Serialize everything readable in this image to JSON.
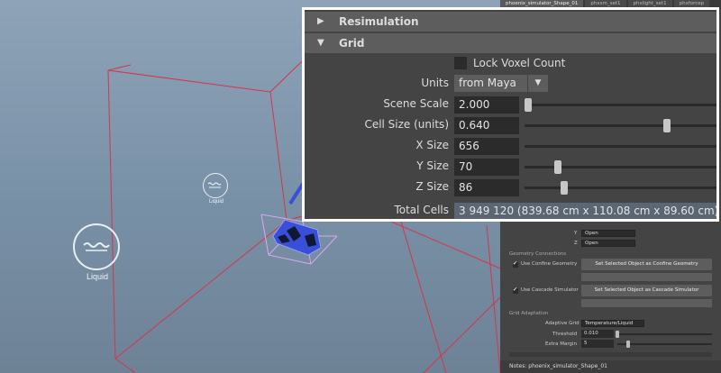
{
  "viewport": {
    "liquid_label": "Liquid",
    "liquid_label_small": "Liquid"
  },
  "attr_editor": {
    "node_tabs": [
      "phoenix_simulator_Shape_01",
      "phxsm_set1",
      "phxlight_set1",
      "phxforcep"
    ],
    "y_label": "Y",
    "y_value": "Open",
    "z_label": "Z",
    "z_value": "Open",
    "geometry_connections": "Geometry Connections",
    "use_confine_geometry": "Use Confine Geometry",
    "set_confine_button": "Set Selected Object as Confine Geometry",
    "use_cascade_simulator": "Use Cascade Simulator",
    "set_cascade_button": "Set Selected Object as Cascade Simulator",
    "grid_adaptation": "Grid Adaptation",
    "adaptive_grid_label": "Adaptive Grid",
    "adaptive_grid_value": "Temperature/Liquid",
    "threshold_label": "Threshold",
    "threshold_value": "0.010",
    "extra_margin_label": "Extra Margin",
    "extra_margin_value": "5",
    "notes": "Notes:  phoenix_simulator_Shape_01"
  },
  "zoom_panel": {
    "resimulation_header": "Resimulation",
    "grid_header": "Grid",
    "lock_voxel_count": "Lock Voxel Count",
    "units_label": "Units",
    "units_value": "from Maya",
    "scene_scale_label": "Scene Scale",
    "scene_scale_value": "2.000",
    "cell_size_label": "Cell Size (units)",
    "cell_size_value": "0.640",
    "x_size_label": "X Size",
    "x_size_value": "656",
    "y_size_label": "Y Size",
    "y_size_value": "70",
    "z_size_label": "Z Size",
    "z_size_value": "86",
    "total_cells_label": "Total Cells",
    "total_cells_value": "3 949 120 (839.68 cm x 110.08 cm x 89.60 cm)"
  },
  "colors": {
    "arrow": "#f2ef1f",
    "wireframe": "#d8344a",
    "selection": "#d9a8f0"
  }
}
